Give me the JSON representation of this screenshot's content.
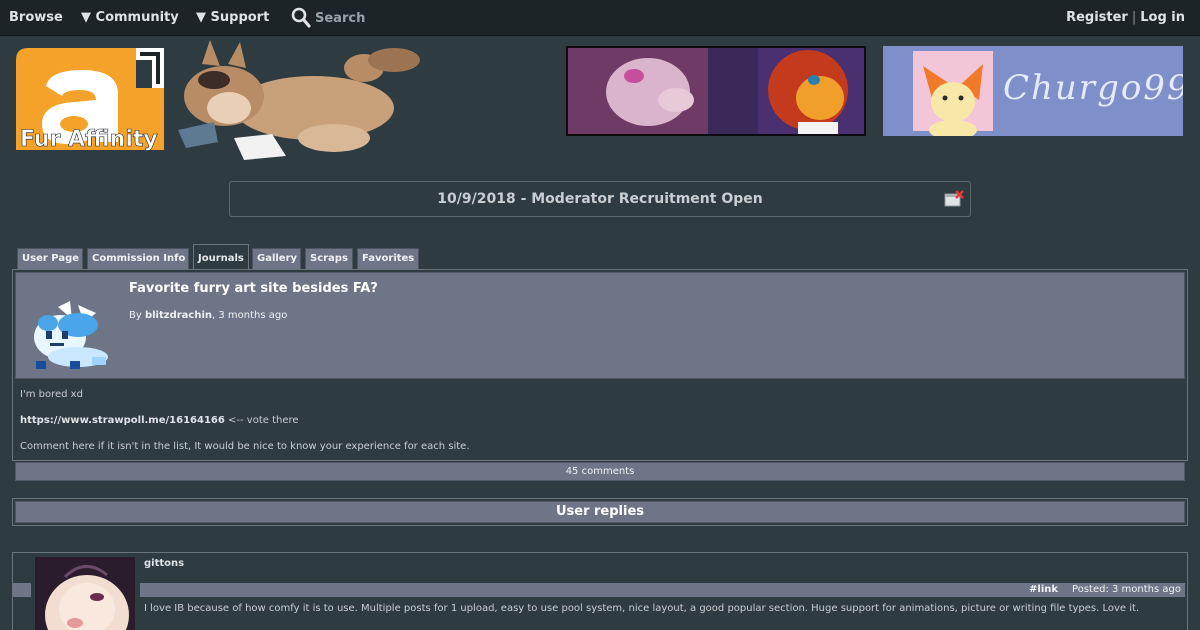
{
  "nav": {
    "browse": "Browse",
    "community": "▼ Community",
    "support": "▼ Support",
    "search": "Search",
    "register": "Register",
    "separator": "|",
    "login": "Log in"
  },
  "logo": {
    "text": "Fur Affinity"
  },
  "banner2": {
    "signature": "Churgo99"
  },
  "notice": {
    "text": "10/9/2018 - Moderator Recruitment Open"
  },
  "tabs": [
    "User Page",
    "Commission Info",
    "Journals",
    "Gallery",
    "Scraps",
    "Favorites"
  ],
  "journal": {
    "title": "Favorite furry art site besides FA?",
    "by_prefix": "By",
    "author": "blitzdrachin",
    "age": ", 3 months ago",
    "line1": "I'm bored xd",
    "link": "https://www.strawpoll.me/16164166",
    "link_suffix": " <-- vote there",
    "line3": "Comment here if it isn't in the list, It would be nice to know your experience for each site.",
    "comments": "45 comments"
  },
  "replies": {
    "title": "User replies"
  },
  "comment": {
    "username": "gittons",
    "link": "#link",
    "posted": "Posted: 3 months ago",
    "text": "I love IB because of how comfy it is to use. Multiple posts for 1 upload, easy to use pool system, nice layout, a good popular section. Huge support for animations, picture or writing file types. Love it."
  },
  "colors": {
    "background": "#2e3b41",
    "header_bar": "#6d7586",
    "topnav": "#1c2427",
    "logo_orange": "#f5a22a"
  }
}
